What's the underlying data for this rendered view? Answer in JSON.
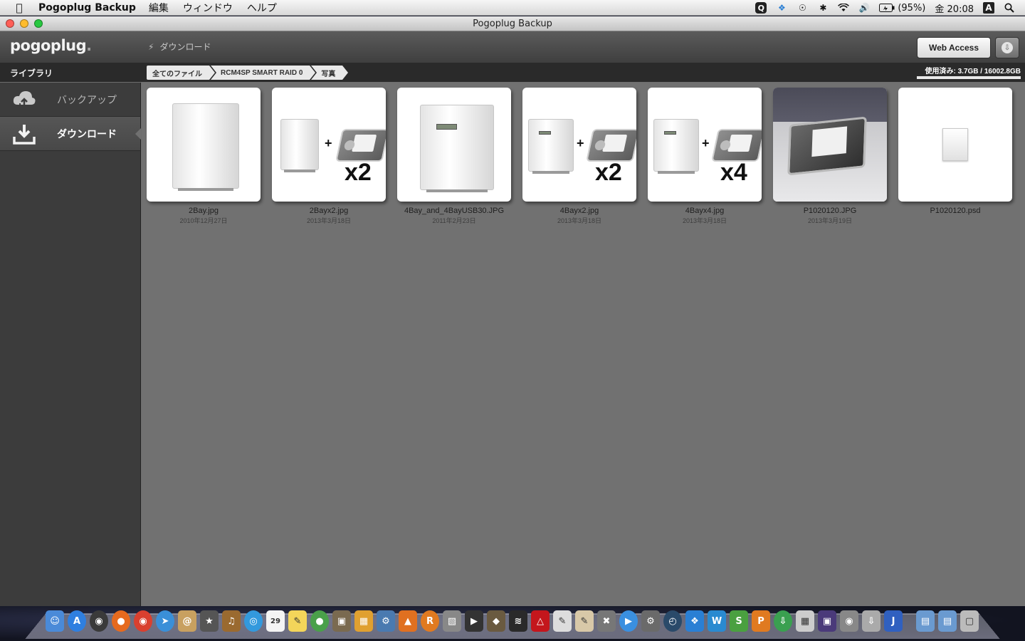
{
  "menubar": {
    "app_name": "Pogoplug Backup",
    "menus": [
      "編集",
      "ウィンドウ",
      "ヘルプ"
    ],
    "battery": "(95%)",
    "clock": "金 20:08",
    "input_mode": "A"
  },
  "window": {
    "title": "Pogoplug Backup"
  },
  "toolbar": {
    "logo": "pogoplug",
    "current_section": "ダウンロード",
    "web_access_label": "Web Access"
  },
  "pathbar": {
    "library_label": "ライブラリ",
    "crumbs": [
      "全てのファイル",
      "RCM4SP SMART RAID 0",
      "写真"
    ],
    "usage": "使用済み: 3.7GB / 16002.8GB"
  },
  "sidebar": {
    "items": [
      {
        "label": "バックアップ",
        "icon": "cloud-sync-icon",
        "active": false
      },
      {
        "label": "ダウンロード",
        "icon": "download-tray-icon",
        "active": true
      }
    ]
  },
  "files": [
    {
      "name": "2Bay.jpg",
      "date": "2010年12月27日"
    },
    {
      "name": "2Bayx2.jpg",
      "date": "2013年3月18日",
      "multiplier": "x2"
    },
    {
      "name": "4Bay_and_4BayUSB30.JPG",
      "date": "2011年2月23日"
    },
    {
      "name": "4Bayx2.jpg",
      "date": "2013年3月18日",
      "multiplier": "x2"
    },
    {
      "name": "4Bayx4.jpg",
      "date": "2013年3月18日",
      "multiplier": "x4"
    },
    {
      "name": "P1020120.JPG",
      "date": "2013年3月19日"
    },
    {
      "name": "P1020120.psd",
      "date": ""
    }
  ],
  "colors": {
    "toolbar_bg": "#4a4a4a",
    "sidebar_bg": "#3c3c3c",
    "content_bg": "#717171",
    "light_close": "#ff5f57",
    "light_min": "#febc2e",
    "light_max": "#28c840"
  }
}
